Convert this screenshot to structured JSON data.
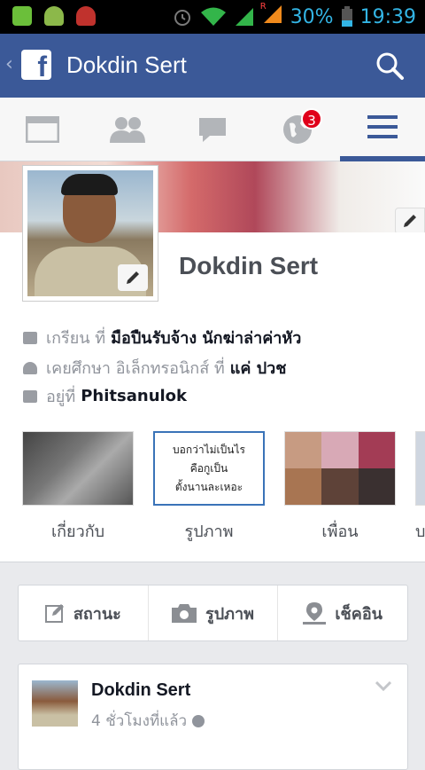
{
  "status_bar": {
    "battery": "30%",
    "time": "19:39",
    "notification_icons": [
      "line-icon",
      "android-icon",
      "android-red-icon"
    ],
    "system_icons": [
      "alarm-icon",
      "wifi-icon",
      "signal-icon",
      "roaming-signal-icon",
      "battery-icon"
    ],
    "roaming_label": "R"
  },
  "action_bar": {
    "back_glyph": "‹",
    "logo_letter": "f",
    "title": "Dokdin Sert"
  },
  "tabs": {
    "active": "menu",
    "notifications_badge": "3"
  },
  "profile": {
    "name": "Dokdin Sert",
    "work_prefix": "เกรียน ที่",
    "work_value": "มือปืนรับจ้าง นักฆ่าล่าค่าหัว",
    "study_prefix": "เคยศึกษา อิเล็กทรอนิกส์ ที่",
    "study_value": "แค่ ปวช",
    "live_prefix": "อยู่ที่",
    "live_value": "Phitsanulok"
  },
  "tiles": [
    {
      "label": "เกี่ยวกับ"
    },
    {
      "label": "รูปภาพ",
      "thumb_lines": [
        "บอกว่าไม่เป็นไร",
        "คือกูเป็น",
        "ตั้งนานละเหอะ"
      ]
    },
    {
      "label": "เพื่อน"
    },
    {
      "label": "บ"
    }
  ],
  "actions": {
    "status": "สถานะ",
    "photo": "รูปภาพ",
    "checkin": "เช็คอิน"
  },
  "post": {
    "author": "Dokdin Sert",
    "time": "4 ชั่วโมงที่แล้ว"
  },
  "colors": {
    "fb_blue": "#3b5998",
    "status_bar_accent": "#33b5e5",
    "badge_red": "#e0001a"
  }
}
